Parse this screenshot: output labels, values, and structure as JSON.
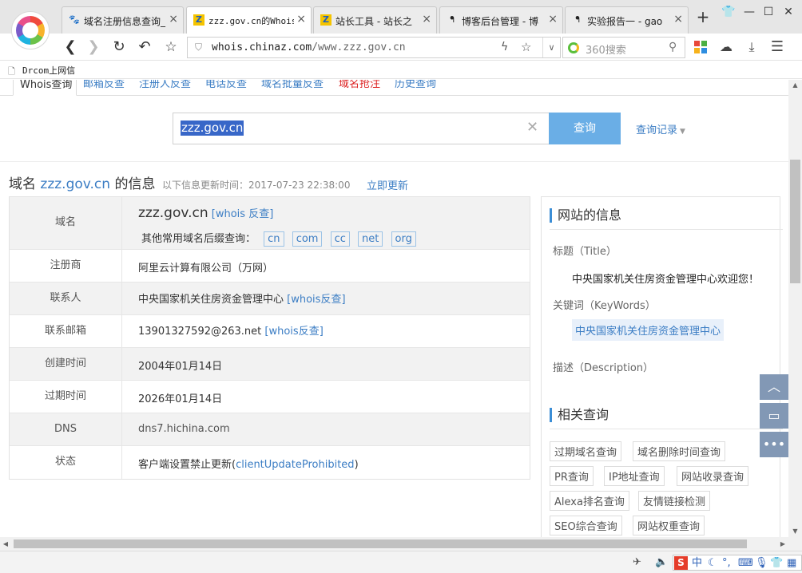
{
  "tabs": [
    {
      "label": "域名注册信息查询_",
      "icon": "paw-icon",
      "active": false
    },
    {
      "label": "zzz.gov.cn的Whois",
      "icon": "chinaz-icon",
      "active": true
    },
    {
      "label": "站长工具 - 站长之",
      "icon": "chinaz-icon",
      "active": false
    },
    {
      "label": "博客后台管理 - 博",
      "icon": "blog-icon",
      "active": false
    },
    {
      "label": "实验报告一 - gao",
      "icon": "blog-icon",
      "active": false
    }
  ],
  "toolbar": {
    "url_host": "whois.chinaz.com",
    "url_path": "/www.zzz.gov.cn",
    "search_placeholder": "360搜索"
  },
  "bookmarks": [
    {
      "label": "Drcom上网信"
    }
  ],
  "subnav": [
    "Whois查询",
    "邮箱反查",
    "注册人反查",
    "电话反查",
    "域名批量反查",
    "域名抢注",
    "历史查询"
  ],
  "query": {
    "value": "zzz.gov.cn",
    "button": "查询",
    "history": "查询记录"
  },
  "info": {
    "heading_prefix": "域名",
    "domain": "zzz.gov.cn",
    "heading_suffix": "的信息",
    "updated": "以下信息更新时间：2017-07-23 22:38:00",
    "refresh": "立即更新"
  },
  "whois": {
    "domain_label": "域名",
    "domain": "zzz.gov.cn",
    "domain_link": "[whois 反查]",
    "suffix_prompt": "其他常用域名后缀查询：",
    "suffixes": [
      "cn",
      "com",
      "cc",
      "net",
      "org"
    ],
    "rows": [
      {
        "label": "注册商",
        "value": "阿里云计算有限公司（万网）",
        "link": ""
      },
      {
        "label": "联系人",
        "value": "中央国家机关住房资金管理中心",
        "link": "[whois反查]"
      },
      {
        "label": "联系邮箱",
        "value": "13901327592@263.net",
        "link": "[whois反查]"
      },
      {
        "label": "创建时间",
        "value": "2004年01月14日",
        "link": ""
      },
      {
        "label": "过期时间",
        "value": "2026年01月14日",
        "link": ""
      },
      {
        "label": "DNS",
        "value": "dns7.hichina.com",
        "link": ""
      }
    ],
    "status_label": "状态",
    "status_prefix": "客户端设置禁止更新(",
    "status_link": "clientUpdateProhibited",
    "status_suffix": ")"
  },
  "sidebar": {
    "site_heading": "网站的信息",
    "title_label": "标题（Title）",
    "title_value": "中央国家机关住房资金管理中心欢迎您！",
    "keywords_label": "关键词（KeyWords）",
    "keyword": "中央国家机关住房资金管理中心",
    "desc_label": "描述（Description）",
    "related_heading": "相关查询",
    "related": [
      "过期域名查询",
      "域名删除时间查询",
      "PR查询",
      "IP地址查询",
      "网站收录查询",
      "Alexa排名查询",
      "友情链接检测",
      "SEO综合查询",
      "网站权重查询"
    ]
  },
  "ime": {
    "lang": "中"
  }
}
